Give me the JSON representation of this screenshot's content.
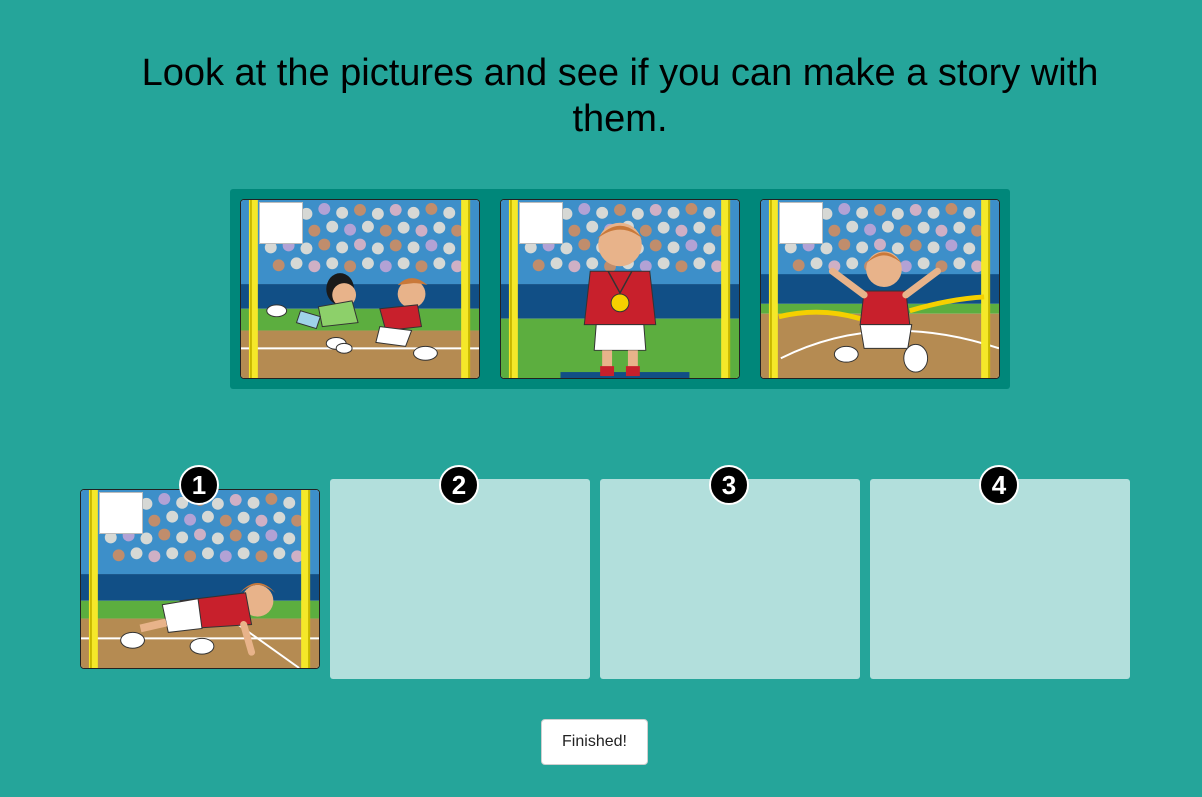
{
  "instruction": "Look at the pictures and see if you can make a story with them.",
  "source_cards": [
    {
      "name": "card-race-running"
    },
    {
      "name": "card-medal-winner"
    },
    {
      "name": "card-finish-line"
    }
  ],
  "slots": [
    {
      "number": "1",
      "filled": true
    },
    {
      "number": "2",
      "filled": false
    },
    {
      "number": "3",
      "filled": false
    },
    {
      "number": "4",
      "filled": false
    }
  ],
  "colors": {
    "background": "#25a59a",
    "tray": "#00877a",
    "slot_empty": "#b2dfdc",
    "badge": "#000000"
  },
  "finish_button": {
    "label": "Finished!"
  }
}
